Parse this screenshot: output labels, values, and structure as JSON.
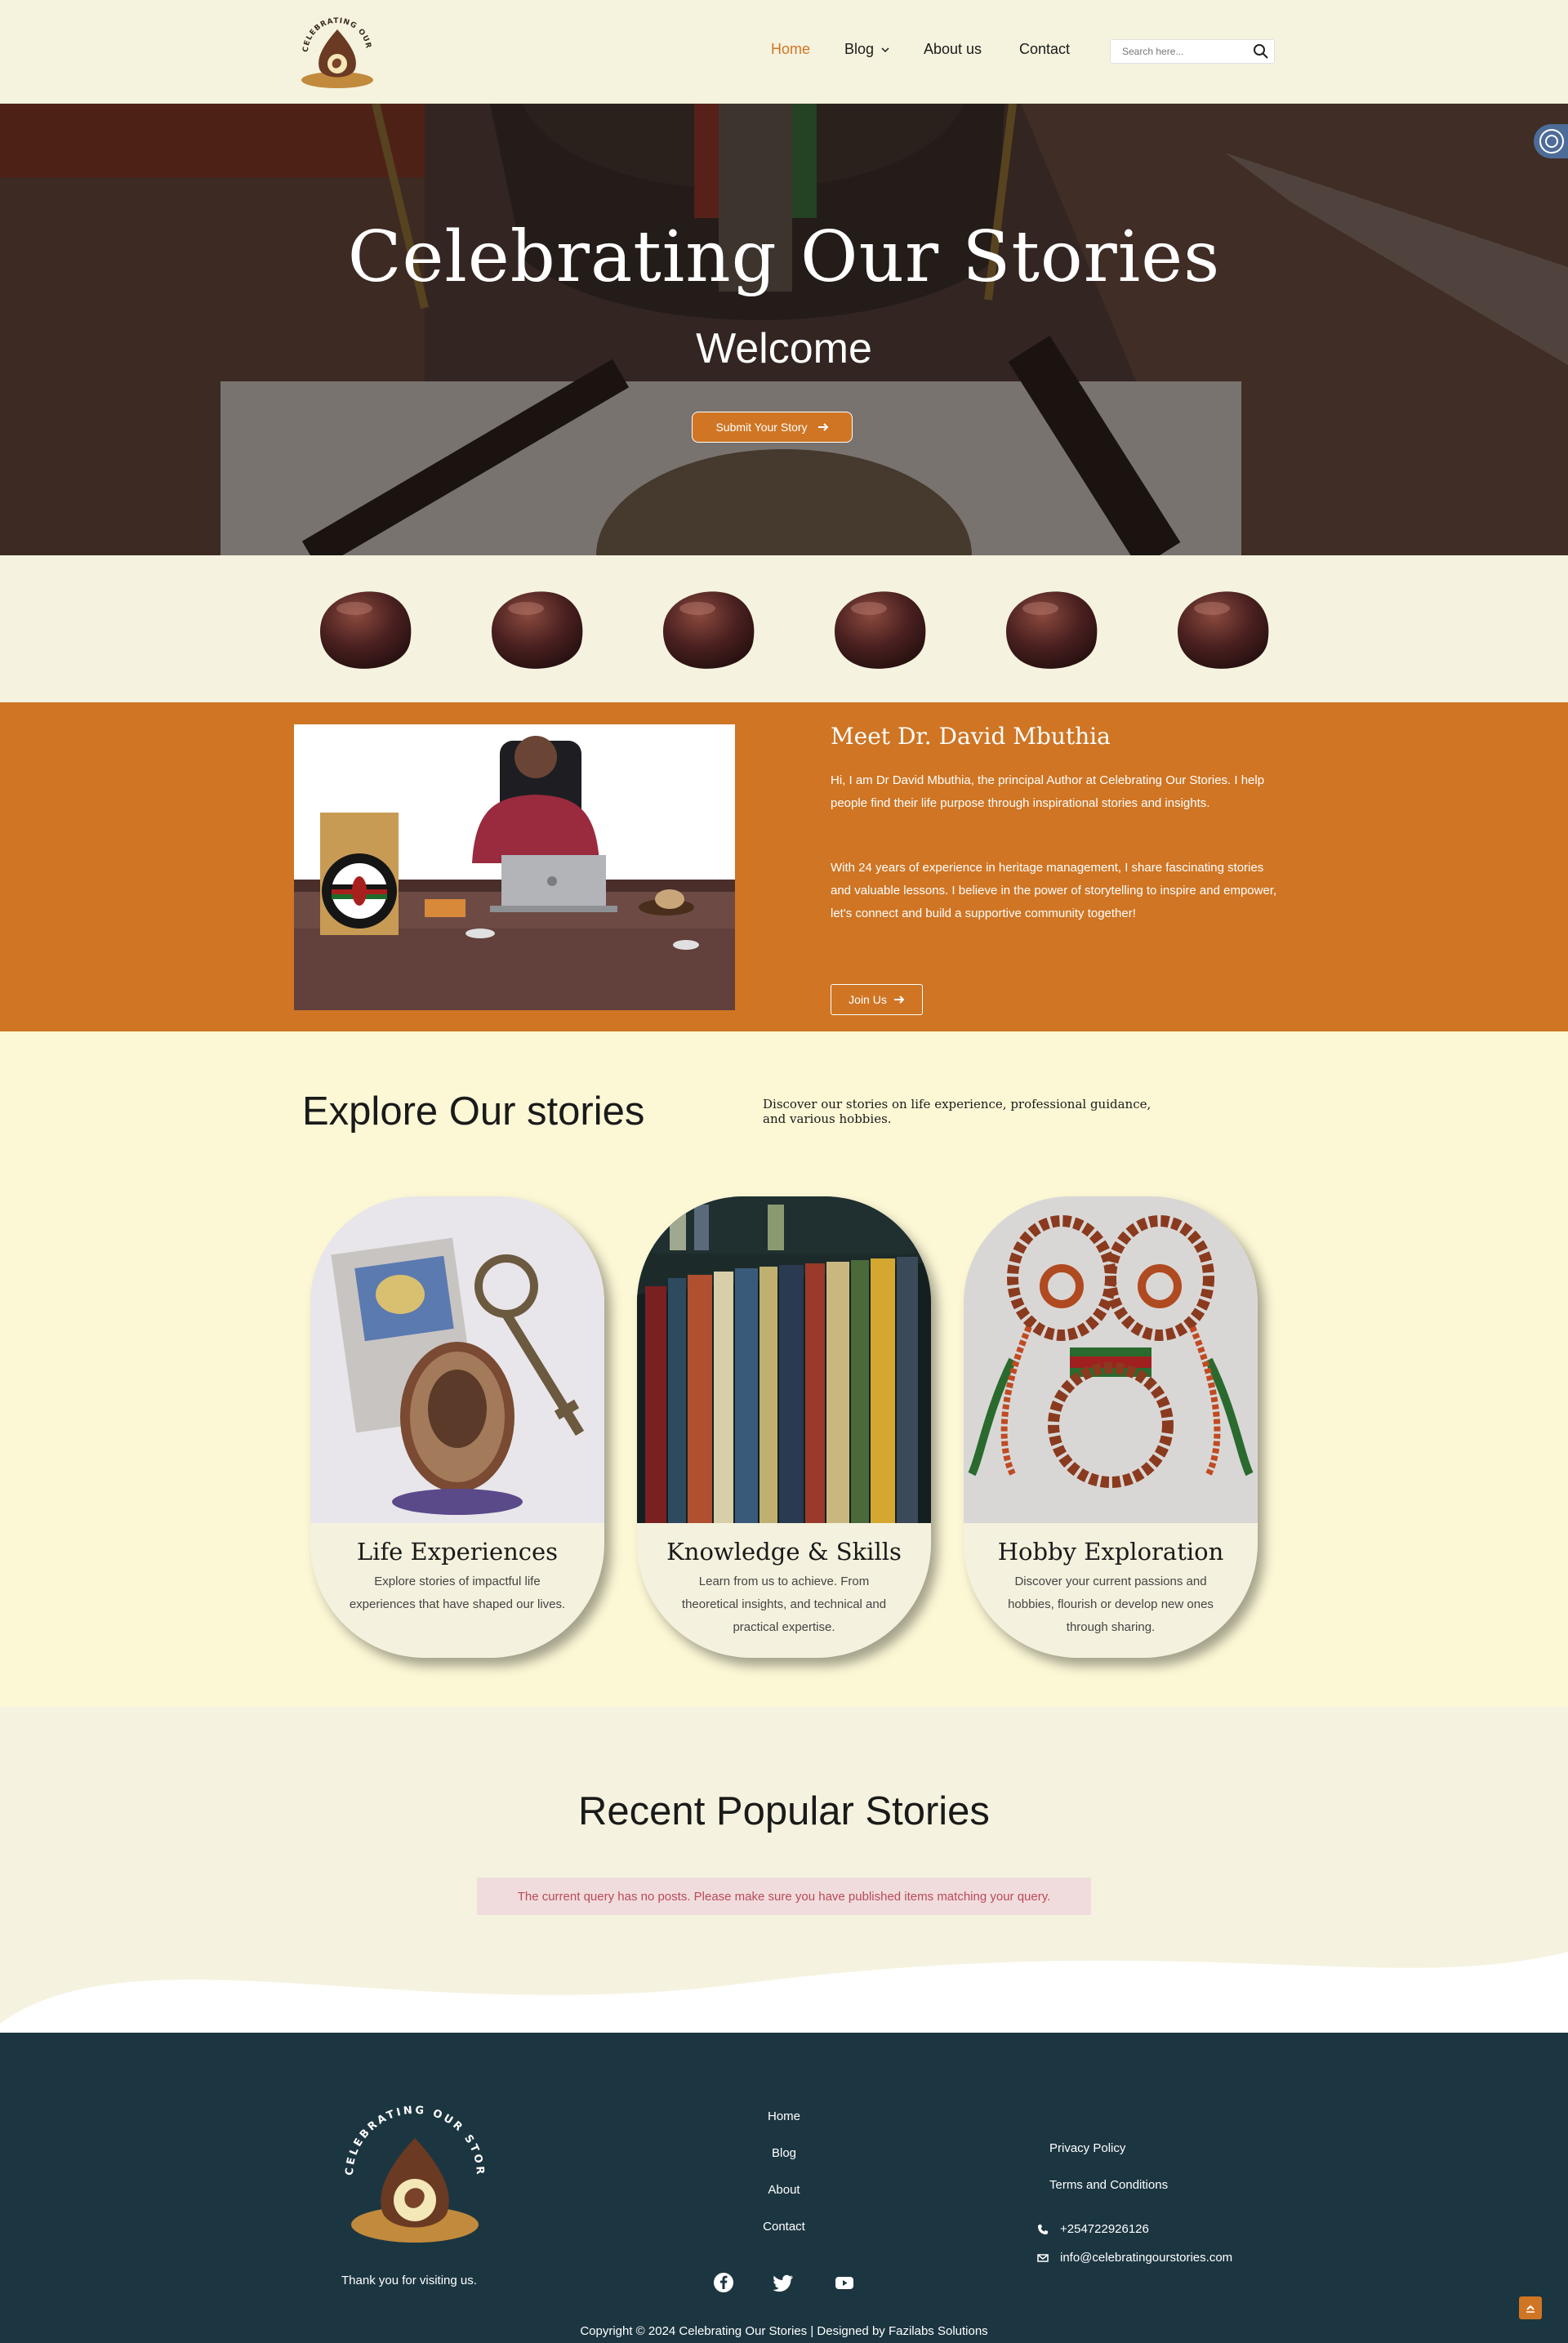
{
  "header": {
    "nav": {
      "home": "Home",
      "blog": "Blog",
      "about": "About us",
      "contact": "Contact"
    },
    "search_placeholder": "Search here...",
    "logo_text": "CELEBRATING OUR STORIES"
  },
  "hero": {
    "title": "Celebrating Our Stories",
    "subtitle": "Welcome",
    "cta": "Submit Your Story"
  },
  "meet": {
    "title": "Meet Dr. David Mbuthia",
    "paragraph1": "Hi, I am Dr David Mbuthia, the principal Author at Celebrating Our Stories. I help people find their life purpose through inspirational stories and insights.",
    "paragraph2": "With 24 years of experience in heritage management, I share fascinating stories and valuable lessons. I believe in the power of storytelling to inspire and empower, let's connect and build a supportive community together!",
    "cta": "Join Us"
  },
  "explore": {
    "title": "Explore Our stories",
    "description": "Discover our stories on life experience, professional guidance, and various hobbies.",
    "cards": [
      {
        "title": "Life Experiences",
        "description": "Explore stories of impactful life experiences that have shaped our lives."
      },
      {
        "title": "Knowledge & Skills",
        "description": "Learn from us to achieve. From theoretical insights, and technical and practical expertise."
      },
      {
        "title": "Hobby Exploration",
        "description": "Discover your current passions and hobbies, flourish or develop new ones through sharing."
      }
    ]
  },
  "recent": {
    "title": "Recent Popular Stories",
    "notice": "The current query has no posts. Please make sure you have published items matching your query."
  },
  "footer": {
    "tagline": "Thank you for visiting us.",
    "links": [
      "Home",
      "Blog",
      "About",
      "Contact"
    ],
    "legal": [
      "Privacy Policy",
      "Terms and Conditions"
    ],
    "phone": "+254722926126",
    "email": "info@celebratingourstories.com",
    "copyright": "Copyright © 2024 Celebrating Our Stories | Designed by Fazilabs Solutions"
  },
  "colors": {
    "accent": "#cf7524",
    "cream": "#f5f3df",
    "explore_bg": "#fcf8d6",
    "footer_bg": "#1c3641"
  },
  "icons": [
    "search-icon",
    "chevron-down-icon",
    "arrow-right-icon",
    "facebook-icon",
    "twitter-icon",
    "youtube-icon",
    "phone-icon",
    "email-icon",
    "arrow-up-icon"
  ]
}
